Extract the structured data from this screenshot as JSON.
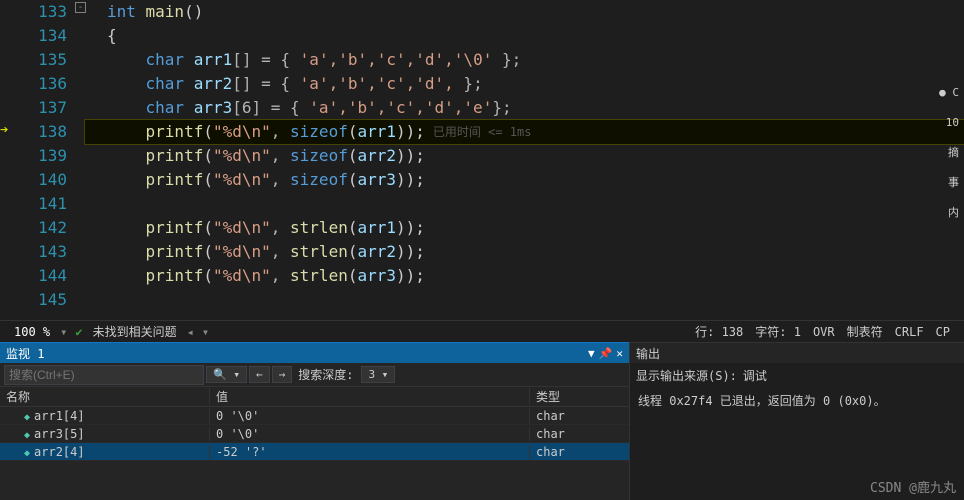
{
  "code": {
    "lines": [
      133,
      134,
      135,
      136,
      137,
      138,
      139,
      140,
      141,
      142,
      143,
      144,
      145
    ],
    "tokens": [
      [
        {
          "t": "int ",
          "c": "k1"
        },
        {
          "t": "main",
          "c": "fn"
        },
        {
          "t": "()",
          "c": "br"
        }
      ],
      [
        {
          "t": "{",
          "c": "br"
        }
      ],
      [
        {
          "t": "    ",
          "c": ""
        },
        {
          "t": "char ",
          "c": "k1"
        },
        {
          "t": "arr1",
          "c": "id"
        },
        {
          "t": "[] = { ",
          "c": "op"
        },
        {
          "t": "'a','b','c','d','\\0'",
          "c": "str"
        },
        {
          "t": " };",
          "c": "op"
        }
      ],
      [
        {
          "t": "    ",
          "c": ""
        },
        {
          "t": "char ",
          "c": "k1"
        },
        {
          "t": "arr2",
          "c": "id"
        },
        {
          "t": "[] = { ",
          "c": "op"
        },
        {
          "t": "'a','b','c','d',",
          "c": "str"
        },
        {
          "t": " };",
          "c": "op"
        }
      ],
      [
        {
          "t": "    ",
          "c": ""
        },
        {
          "t": "char ",
          "c": "k1"
        },
        {
          "t": "arr3",
          "c": "id"
        },
        {
          "t": "[6] = { ",
          "c": "op"
        },
        {
          "t": "'a','b','c','d','e'",
          "c": "str"
        },
        {
          "t": "};",
          "c": "op"
        }
      ],
      [
        {
          "t": "    ",
          "c": ""
        },
        {
          "t": "printf",
          "c": "fn"
        },
        {
          "t": "(",
          "c": "br"
        },
        {
          "t": "\"%d\\n\"",
          "c": "str"
        },
        {
          "t": ", ",
          "c": "op"
        },
        {
          "t": "sizeof",
          "c": "k1"
        },
        {
          "t": "(",
          "c": "br"
        },
        {
          "t": "arr1",
          "c": "id"
        },
        {
          "t": "));",
          "c": "br"
        }
      ],
      [
        {
          "t": "    ",
          "c": ""
        },
        {
          "t": "printf",
          "c": "fn"
        },
        {
          "t": "(",
          "c": "br"
        },
        {
          "t": "\"%d\\n\"",
          "c": "str"
        },
        {
          "t": ", ",
          "c": "op"
        },
        {
          "t": "sizeof",
          "c": "k1"
        },
        {
          "t": "(",
          "c": "br"
        },
        {
          "t": "arr2",
          "c": "id"
        },
        {
          "t": "));",
          "c": "br"
        }
      ],
      [
        {
          "t": "    ",
          "c": ""
        },
        {
          "t": "printf",
          "c": "fn"
        },
        {
          "t": "(",
          "c": "br"
        },
        {
          "t": "\"%d\\n\"",
          "c": "str"
        },
        {
          "t": ", ",
          "c": "op"
        },
        {
          "t": "sizeof",
          "c": "k1"
        },
        {
          "t": "(",
          "c": "br"
        },
        {
          "t": "arr3",
          "c": "id"
        },
        {
          "t": "));",
          "c": "br"
        }
      ],
      [],
      [
        {
          "t": "    ",
          "c": ""
        },
        {
          "t": "printf",
          "c": "fn"
        },
        {
          "t": "(",
          "c": "br"
        },
        {
          "t": "\"%d\\n\"",
          "c": "str"
        },
        {
          "t": ", ",
          "c": "op"
        },
        {
          "t": "strlen",
          "c": "fn"
        },
        {
          "t": "(",
          "c": "br"
        },
        {
          "t": "arr1",
          "c": "id"
        },
        {
          "t": "));",
          "c": "br"
        }
      ],
      [
        {
          "t": "    ",
          "c": ""
        },
        {
          "t": "printf",
          "c": "fn"
        },
        {
          "t": "(",
          "c": "br"
        },
        {
          "t": "\"%d\\n\"",
          "c": "str"
        },
        {
          "t": ", ",
          "c": "op"
        },
        {
          "t": "strlen",
          "c": "fn"
        },
        {
          "t": "(",
          "c": "br"
        },
        {
          "t": "arr2",
          "c": "id"
        },
        {
          "t": "));",
          "c": "br"
        }
      ],
      [
        {
          "t": "    ",
          "c": ""
        },
        {
          "t": "printf",
          "c": "fn"
        },
        {
          "t": "(",
          "c": "br"
        },
        {
          "t": "\"%d\\n\"",
          "c": "str"
        },
        {
          "t": ", ",
          "c": "op"
        },
        {
          "t": "strlen",
          "c": "fn"
        },
        {
          "t": "(",
          "c": "br"
        },
        {
          "t": "arr3",
          "c": "id"
        },
        {
          "t": "));",
          "c": "br"
        }
      ],
      []
    ],
    "hint_line": 138,
    "hint_text": "已用时间 <= 1ms"
  },
  "right": {
    "items": [
      "C",
      "10",
      "摘",
      "事",
      "内"
    ]
  },
  "status": {
    "zoom": "100 %",
    "issues": "未找到相关问题",
    "line": "行: 138",
    "chr": "字符: 1",
    "ovr": "OVR",
    "tabs": "制表符",
    "crlf": "CRLF",
    "cpu": "CP"
  },
  "watch": {
    "title": "监视 1",
    "search_placeholder": "搜索(Ctrl+E)",
    "depth_label": "搜索深度:",
    "depth_value": "3",
    "cols": {
      "name": "名称",
      "value": "值",
      "type": "类型"
    },
    "rows": [
      {
        "name": "arr1[4]",
        "value": "0 '\\0'",
        "type": "char",
        "sel": false
      },
      {
        "name": "arr3[5]",
        "value": "0 '\\0'",
        "type": "char",
        "sel": false
      },
      {
        "name": "arr2[4]",
        "value": "-52 '?'",
        "type": "char",
        "sel": true
      }
    ]
  },
  "output": {
    "title": "输出",
    "src_label": "显示输出来源(S):",
    "src_value": "调试",
    "body": "线程 0x27f4 已退出，返回值为 0 (0x0)。"
  },
  "watermark": "CSDN @鹿九丸"
}
